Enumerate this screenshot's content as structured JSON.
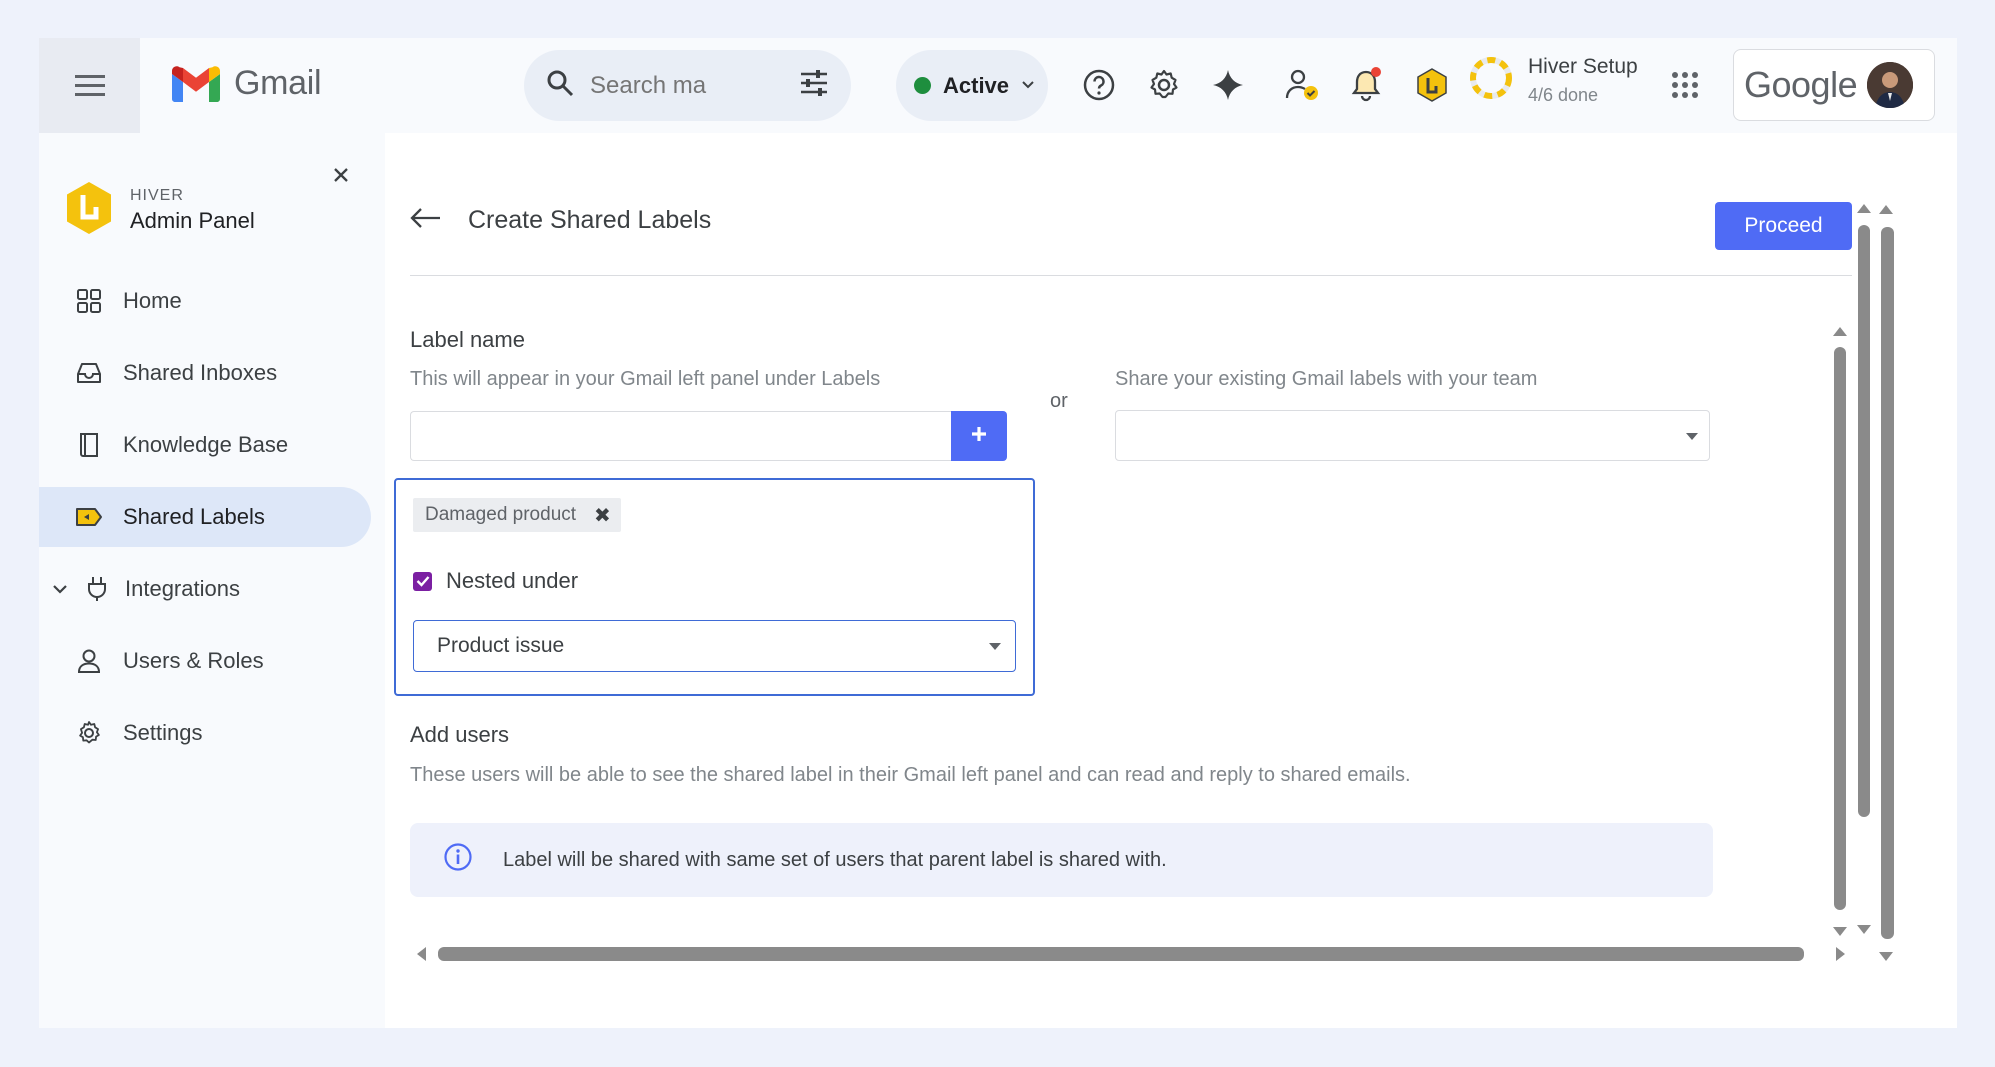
{
  "topbar": {
    "app_name": "Gmail",
    "search": {
      "placeholder": "Search ma"
    },
    "status": {
      "label": "Active",
      "color": "#1e8e3e"
    },
    "icons": [
      "menu-icon",
      "search-icon",
      "filter-sliders-icon",
      "help-icon",
      "gear-icon",
      "sparkle-icon",
      "user-check-icon",
      "bell-icon",
      "hiver-icon",
      "apps-grid-icon"
    ],
    "setup": {
      "title": "Hiver Setup",
      "progress_text": "4/6 done",
      "progress": 0.6667
    },
    "account_brand": "Google"
  },
  "sidebar": {
    "brand_small": "HIVER",
    "brand_title": "Admin Panel",
    "items": [
      {
        "label": "Home",
        "icon": "grid-icon"
      },
      {
        "label": "Shared Inboxes",
        "icon": "inbox-icon"
      },
      {
        "label": "Knowledge Base",
        "icon": "book-icon"
      },
      {
        "label": "Shared Labels",
        "icon": "label-share-icon",
        "active": true
      },
      {
        "label": "Integrations",
        "icon": "plug-icon",
        "expandable": true
      },
      {
        "label": "Users & Roles",
        "icon": "person-icon"
      },
      {
        "label": "Settings",
        "icon": "gear-icon"
      }
    ]
  },
  "page": {
    "title": "Create Shared Labels",
    "proceed_label": "Proceed",
    "label_name_heading": "Label name",
    "label_name_help": "This will appear in your Gmail left panel under Labels",
    "or_text": "or",
    "existing_help": "Share your existing Gmail labels with your team",
    "label_input_value": "",
    "existing_select_value": "",
    "chip_label": "Damaged product",
    "nested_label": "Nested under",
    "nested_checked": true,
    "parent_select_value": "Product issue",
    "add_users_heading": "Add users",
    "add_users_help": "These users will be able to see the shared label in their Gmail left panel and can read and reply to shared emails.",
    "info_text": "Label will be shared with same set of users that parent label is shared with."
  },
  "colors": {
    "accent": "#4f6bf5",
    "focus_border": "#3f6bd6",
    "active_nav": "#dde7f8",
    "checkbox": "#7b1fa2"
  }
}
